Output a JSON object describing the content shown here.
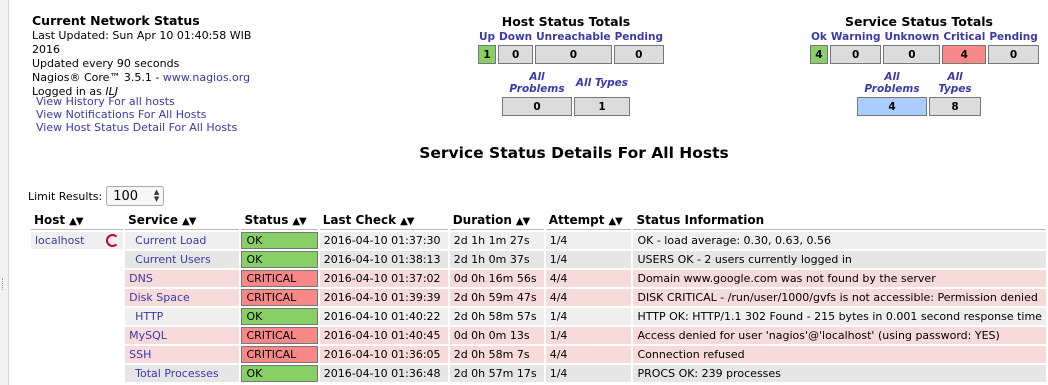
{
  "info": {
    "title": "Current Network Status",
    "last_updated": "Last Updated: Sun Apr 10 01:40:58 WIB 2016",
    "update_interval": "Updated every 90 seconds",
    "version_prefix": "Nagios® Core™ 3.5.1 - ",
    "version_link": "www.nagios.org",
    "logged_in_prefix": "Logged in as ",
    "logged_in_user": "ILJ"
  },
  "links": [
    "View History For all hosts",
    "View Notifications For All Hosts",
    "View Host Status Detail For All Hosts"
  ],
  "host_totals": {
    "title": "Host Status Totals",
    "headers": [
      "Up",
      "Down",
      "Unreachable",
      "Pending"
    ],
    "values": [
      "1",
      "0",
      "0",
      "0"
    ],
    "problem_headers": [
      "All Problems",
      "All Types"
    ],
    "problem_values": [
      "0",
      "1"
    ]
  },
  "service_totals": {
    "title": "Service Status Totals",
    "headers": [
      "Ok",
      "Warning",
      "Unknown",
      "Critical",
      "Pending"
    ],
    "values": [
      "4",
      "0",
      "0",
      "4",
      "0"
    ],
    "problem_headers": [
      "All Problems",
      "All Types"
    ],
    "problem_values": [
      "4",
      "8"
    ]
  },
  "page_title": "Service Status Details For All Hosts",
  "limit": {
    "label": "Limit Results:",
    "value": "100"
  },
  "table": {
    "headers": [
      "Host",
      "Service",
      "Status",
      "Last Check",
      "Duration",
      "Attempt",
      "Status Information"
    ],
    "host": "localhost",
    "rows": [
      {
        "service": "Current Load",
        "status": "OK",
        "last_check": "2016-04-10 01:37:30",
        "duration": "2d 1h 1m 27s",
        "attempt": "1/4",
        "info": "OK - load average: 0.30, 0.63, 0.56"
      },
      {
        "service": "Current Users",
        "status": "OK",
        "last_check": "2016-04-10 01:38:13",
        "duration": "2d 1h 0m 37s",
        "attempt": "1/4",
        "info": "USERS OK - 2 users currently logged in"
      },
      {
        "service": "DNS",
        "status": "CRITICAL",
        "last_check": "2016-04-10 01:37:02",
        "duration": "0d 0h 16m 56s",
        "attempt": "4/4",
        "info": "Domain www.google.com was not found by the server"
      },
      {
        "service": "Disk Space",
        "status": "CRITICAL",
        "last_check": "2016-04-10 01:39:39",
        "duration": "2d 0h 59m 47s",
        "attempt": "4/4",
        "info": "DISK CRITICAL - /run/user/1000/gvfs is not accessible: Permission denied"
      },
      {
        "service": "HTTP",
        "status": "OK",
        "last_check": "2016-04-10 01:40:22",
        "duration": "2d 0h 58m 57s",
        "attempt": "1/4",
        "info": "HTTP OK: HTTP/1.1 302 Found - 215 bytes in 0.001 second response time"
      },
      {
        "service": "MySQL",
        "status": "CRITICAL",
        "last_check": "2016-04-10 01:40:45",
        "duration": "0d 0h 0m 13s",
        "attempt": "1/4",
        "info": "Access denied for user 'nagios'@'localhost' (using password: YES)"
      },
      {
        "service": "SSH",
        "status": "CRITICAL",
        "last_check": "2016-04-10 01:36:05",
        "duration": "2d 0h 58m 7s",
        "attempt": "4/4",
        "info": "Connection refused"
      },
      {
        "service": "Total Processes",
        "status": "OK",
        "last_check": "2016-04-10 01:36:48",
        "duration": "2d 0h 57m 17s",
        "attempt": "1/4",
        "info": "PROCS OK: 239 processes"
      }
    ]
  },
  "colors": {
    "ok": "#88d066",
    "critical": "#f88888",
    "blue": "#aaccff",
    "link": "#3a3aa8"
  },
  "icons": {
    "sort": "sort-arrows-icon",
    "host": "debian-swirl-icon"
  }
}
